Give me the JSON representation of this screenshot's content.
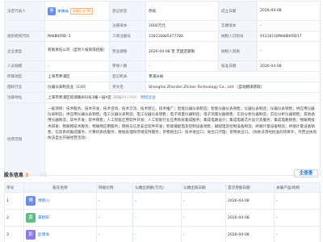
{
  "labels": {
    "legal_rep": "法定代表人",
    "reg_status": "登记状态",
    "est_date": "成立日期",
    "reg_capital": "注册资本",
    "paid_capital": "实缴资本",
    "org_code": "组织机构代码",
    "biz_reg_no": "工商注册号",
    "taxpayer_id": "纳税人识别号",
    "company_type": "企业类型",
    "biz_term": "营业期限",
    "taxpayer_qual": "纳税人资质",
    "staff_size": "人员规模",
    "insured_count": "参保人数",
    "approval_date": "核准日期",
    "region": "所属地区",
    "reg_authority": "登记机关",
    "industry": "国标行业",
    "english_name": "英文名",
    "address": "注册地址",
    "scope": "经营范围"
  },
  "values": {
    "legal_rep_avatar": "李",
    "legal_rep_name": "李博伟",
    "legal_rep_tag": "关联企业 16",
    "reg_status": "存续",
    "est_date": "2026-04-08",
    "reg_capital": "2000万元",
    "paid_capital": "-",
    "org_code": "MAKBHFRD-1",
    "biz_reg_no": "310116005477786",
    "taxpayer_id": "91310118MAKBHFRD17",
    "company_type": "有限责任公司（自然人投资或控股）",
    "biz_term": "2026-04-08 至 无固定期限",
    "taxpayer_qual": "-",
    "staff_size": "-",
    "insured_count": "-",
    "approval_date": "2026-04-08",
    "region": "上海市青浦区",
    "reg_authority": "青浦分局",
    "industry": "仪器仪表制造业（C40）",
    "english_name": "Shanghai Zhenlan Zhilian Technology Co., Ltd.（自动翻译获取）",
    "address": "上海市青浦区岐浦路800号1幢一层A区",
    "address_note": "(邮编201700)",
    "address_link": "附近企业",
    "scope": "一般项目：技术服务、技术开发、技术咨询、技术交流、技术转让、技术推广；智能仪器仪表制造；智能仪器仪表销售；仪器仪表制造；仪器仪表销售；供应用仪器仪表制造；供应用仪器仪表销售；电工仪器仪表制造；电工仪器仪表销售；电子测量仪器制造；电子测量仪器销售；实验分析仪器制造；实验分析仪器销售；其他通用仪器制造；软件开发；软件销售；人工智能应用软件开发；人工智能行业应用系统集成服务；集成电路设计；集成电路芯片设计及服务；集成电路销售；物联网技术研发；物联网技术服务；物联网应用服务；网络与信息安全软件开发；智能输配电及控制设备销售；输配电及控制设备制造；终端计量设备制造；终端计量设备销售；信息系统集成服务；计算机系统服务；数据处理和存储支持服务；货物进出口；技术进出口；进出口代理；货物进出口。（除依法须经批准的项目外，凭营业执照依法自主开展经营活动）"
  },
  "holders": {
    "title": "股东信息",
    "count": "3",
    "brand": "企查查",
    "columns": [
      "序号",
      "股东名称",
      "持股比例",
      "认缴出资额(万元)",
      "认缴出资日期",
      "首次持股日期",
      "关联产品/机构"
    ],
    "rows": [
      {
        "index": "1",
        "avatar": "博",
        "avatar_color": "#6d8ee8",
        "name": "博南川",
        "ratio": "-",
        "amount": "-",
        "date": "-",
        "first_date": "2026-04-08",
        "related": "-"
      },
      {
        "index": "2",
        "avatar": "黄",
        "avatar_color": "#5cbf87",
        "name": "黄智研",
        "ratio": "-",
        "amount": "-",
        "date": "-",
        "first_date": "2026-04-08",
        "related": "-"
      },
      {
        "index": "3",
        "avatar": "彭",
        "avatar_color": "#8f7ae0",
        "name": "彭博涛",
        "ratio": "-",
        "amount": "-",
        "date": "-",
        "first_date": "2026-04-08",
        "related": "-"
      }
    ]
  },
  "colors": {
    "key_bg": "#f2f6fc",
    "border": "#e6ebf2",
    "link": "#1a6fd8",
    "tag": "#ff7a1f"
  }
}
